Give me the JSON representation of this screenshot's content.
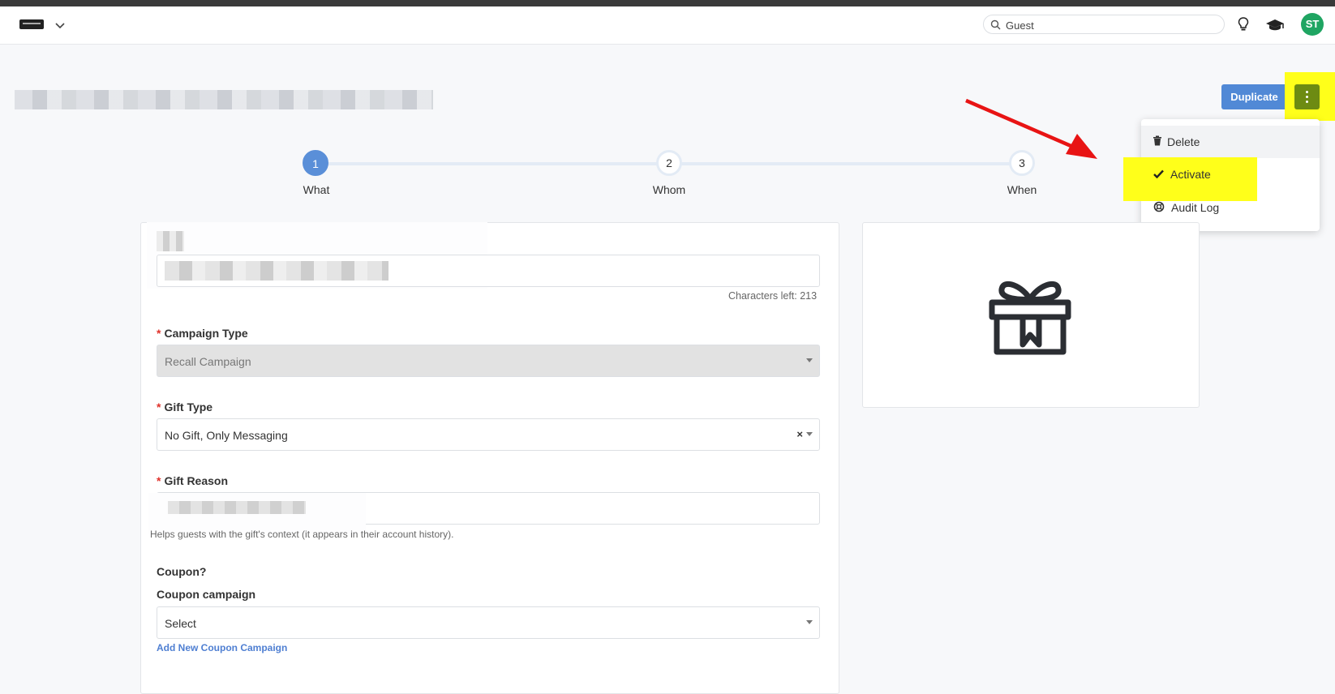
{
  "header": {
    "search": {
      "value": "Guest"
    }
  },
  "actions": {
    "duplicate_label": "Duplicate"
  },
  "menu": {
    "items": [
      {
        "label": "Delete",
        "icon": "trash-icon"
      },
      {
        "label": "Activate",
        "icon": "check-icon"
      },
      {
        "label": "Audit Log",
        "icon": "lifebuoy-icon"
      }
    ]
  },
  "steps": [
    {
      "number": "1",
      "label": "What"
    },
    {
      "number": "2",
      "label": "Whom"
    },
    {
      "number": "3",
      "label": "When"
    }
  ],
  "user": {
    "initials": "ST"
  },
  "form": {
    "name_field": {
      "counter": "Characters left: 213"
    },
    "campaign_type": {
      "label": "Campaign Type",
      "value": "Recall Campaign"
    },
    "gift_type": {
      "label": "Gift Type",
      "value": "No Gift, Only Messaging",
      "clear": "×"
    },
    "gift_reason": {
      "label": "Gift Reason",
      "help": "Helps guests with the gift's context (it appears in their account history)."
    },
    "coupon": {
      "heading": "Coupon?",
      "label": "Coupon campaign",
      "placeholder": "Select",
      "add_link": "Add New Coupon Campaign"
    },
    "required_mark": "*"
  },
  "colors": {
    "primary": "#5189d6",
    "highlight": "#ffff1a",
    "avatar": "#1fa562",
    "annotation_arrow": "#e81414"
  }
}
